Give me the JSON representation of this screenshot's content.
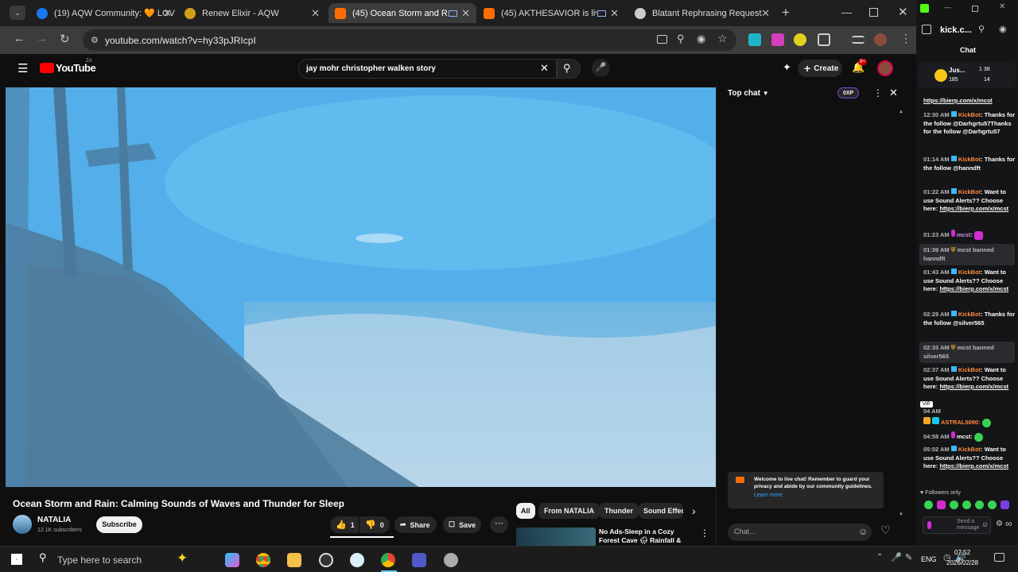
{
  "browser": {
    "tabs": [
      {
        "label": "(19) AQW Community: 🧡 LOV",
        "favicon_color": "#1877f2"
      },
      {
        "label": "Renew Elixir - AQW",
        "favicon_color": "#d4a017"
      },
      {
        "label": "(45) Ocean Storm and Rain",
        "favicon_color": "#ff6d00"
      },
      {
        "label": "(45) AKTHESAVIOR is live!",
        "favicon_color": "#ff6d00"
      },
      {
        "label": "Blatant Rephrasing Request",
        "favicon_color": "#cccccc"
      }
    ],
    "new_tab": "+",
    "url": "youtube.com/watch?v=hy33pJRIcpI"
  },
  "youtube": {
    "logo": "YouTube",
    "logo_region": "ZA",
    "search_query": "jay mohr christopher walken story",
    "create_label": "Create",
    "notif_count": "9+",
    "video_title": "Ocean Storm and Rain: Calming Sounds of Waves and Thunder for Sleep",
    "channel_name": "NATALIA",
    "subscribers": "12.1K subscribers",
    "subscribe_label": "Subscribe",
    "likes": "1",
    "dislikes": "0",
    "share_label": "Share",
    "save_label": "Save",
    "chips": [
      "All",
      "From NATALIA",
      "Thunder",
      "Sound Effec"
    ],
    "rec_title": "No Ads-Sleep in a Cozy Forest Cave 🌧 Rainfall & Fireplace ...",
    "chat": {
      "header": "Top chat",
      "points": "0XP",
      "welcome": "Welcome to live chat! Remember to guard your privacy and abide by our community guidelines.",
      "learn_more": "Learn more",
      "placeholder": "Chat..."
    }
  },
  "kick": {
    "title": "kick.c...",
    "chat_label": "Chat",
    "user": "Jus...",
    "stats": [
      "1 38",
      "185",
      "14"
    ],
    "top_link": "https://bierp.com/x/mcst",
    "messages": [
      {
        "time": "12:30 AM",
        "user": "KickBot",
        "text": "Thanks for the follow @Darhgrtu57Thanks for the follow @Darhgrtu57"
      },
      {
        "time": "01:14 AM",
        "user": "KickBot",
        "text": "Thanks for the follow @hanndft"
      },
      {
        "time": "01:22 AM",
        "user": "KickBot",
        "text": "Want to use Sound Alerts?? Choose here:",
        "link": "https://bierp.com/x/mcst"
      },
      {
        "time": "01:23 AM",
        "user": "mcst",
        "text": ""
      },
      {
        "time": "01:39 AM",
        "user": "mcst banned",
        "text": "hanndft"
      },
      {
        "time": "01:43 AM",
        "user": "KickBot",
        "text": "Want to use Sound Alerts?? Choose here:",
        "link": "https://bierp.com/x/mcst"
      },
      {
        "time": "02:29 AM",
        "user": "KickBot",
        "text": "Thanks for the follow @silver565"
      },
      {
        "time": "02:33 AM",
        "user": "mcst banned",
        "text": "silver565"
      },
      {
        "time": "02:37 AM",
        "user": "KickBot",
        "text": "Want to use Sound Alerts?? Choose here:",
        "link": "https://bierp.com/x/mcst"
      },
      {
        "time": "04 AM",
        "user": "ASTRAL5090:",
        "text": ""
      },
      {
        "time": "04:58 AM",
        "user": "mcst:",
        "text": ""
      },
      {
        "time": "05:02 AM",
        "user": "KickBot",
        "text": "Want to use Sound Alerts?? Choose here:",
        "link": "https://bierp.com/x/mcst"
      }
    ],
    "vip": "VIP",
    "followers_only": "Followers only",
    "send_placeholder": "Send a message"
  },
  "taskbar": {
    "search_placeholder": "Type here to search",
    "lang": "ENG",
    "time": "07:52",
    "date": "2026/02/28"
  }
}
